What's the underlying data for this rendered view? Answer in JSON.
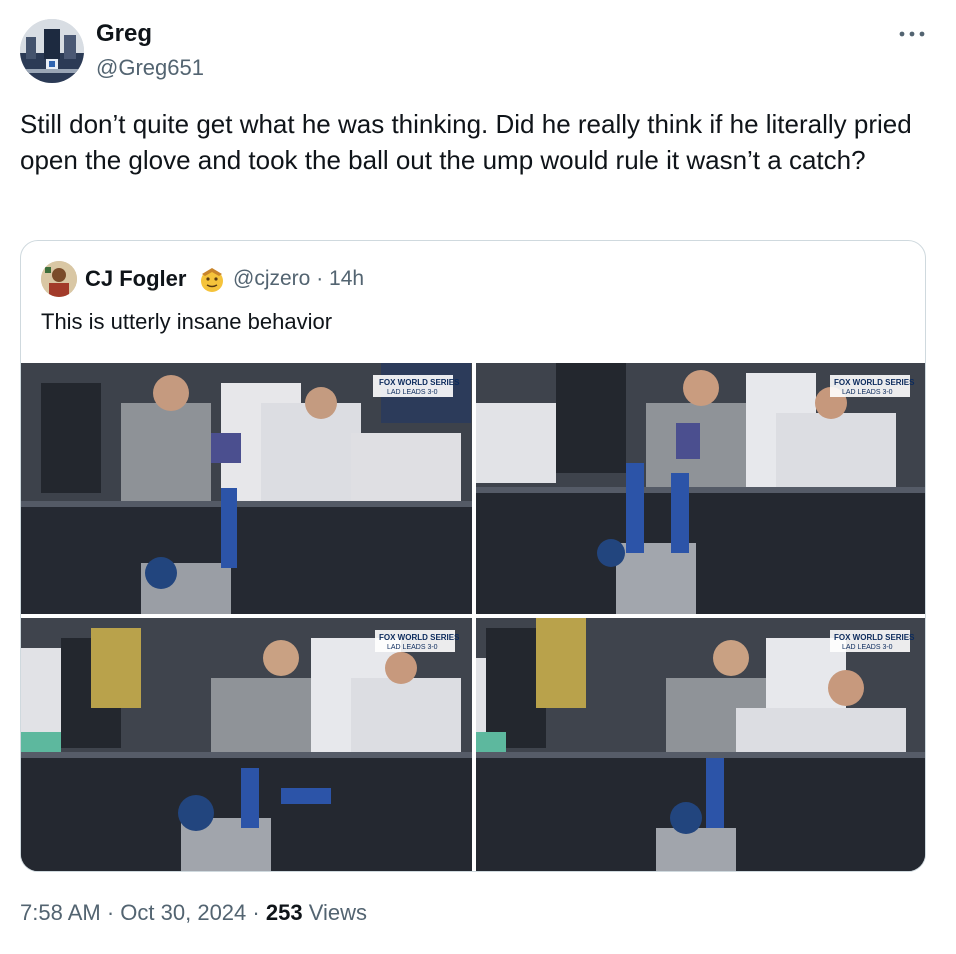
{
  "tweet": {
    "author": {
      "display_name": "Greg",
      "handle": "@Greg651"
    },
    "text": "Still don’t quite get what he was thinking. Did he really think if he literally pried open the glove and took the ball out the ump would rule it wasn’t a catch?",
    "time": "7:58 AM",
    "date": "Oct 30, 2024",
    "separator": "·",
    "views_count": "253",
    "views_label": "Views"
  },
  "quote": {
    "author": {
      "display_name": "CJ Fogler",
      "handle": "@cjzero",
      "age": "14h"
    },
    "separator": "·",
    "text": "This is utterly insane behavior",
    "badge_icon": "emoji-face-icon"
  },
  "media": {
    "overlay": {
      "brand": "FOX",
      "title": "WORLD SERIES",
      "score": "LAD LEADS 3-0"
    },
    "panels": [
      {
        "id": "top-left"
      },
      {
        "id": "top-right"
      },
      {
        "id": "bottom-left"
      },
      {
        "id": "bottom-right"
      }
    ]
  },
  "colors": {
    "text_primary": "#0f1419",
    "text_secondary": "#536471",
    "border": "#cfd9de"
  }
}
